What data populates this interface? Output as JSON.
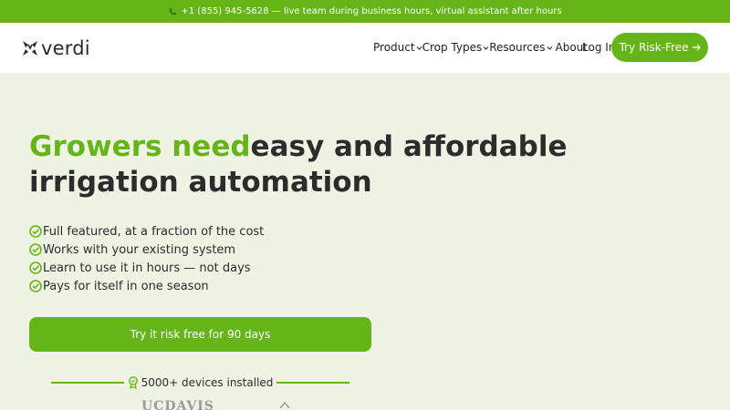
{
  "topbar": {
    "text": "+1 (855) 945-5628 — live team during business hours, virtual assistant after hours",
    "icon": "phone-icon"
  },
  "brand": {
    "name": "verdi",
    "icon": "verdi-logo-icon"
  },
  "nav": {
    "items": [
      {
        "label": "Product",
        "has_dropdown": true
      },
      {
        "label": "Crop Types",
        "has_dropdown": true
      },
      {
        "label": "Resources",
        "has_dropdown": true
      },
      {
        "label": "About",
        "has_dropdown": false
      }
    ],
    "login_label": "Log In",
    "try_label": "Try Risk-Free"
  },
  "hero": {
    "title_accent": "Growers need",
    "title_rest": "easy and affordable irrigation automation",
    "features": [
      "Full featured, at a fraction of the cost",
      "Works with your existing system",
      "Learn to use it in hours — not days",
      "Pays for itself in one season"
    ],
    "cta_label": "Try it risk free for 90 days",
    "devices_label": "5000+ devices installed"
  },
  "partners": {
    "first": "UCDAVIS"
  },
  "colors": {
    "accent": "#66b518",
    "background": "#eef3e4",
    "text": "#2c2c2c"
  }
}
